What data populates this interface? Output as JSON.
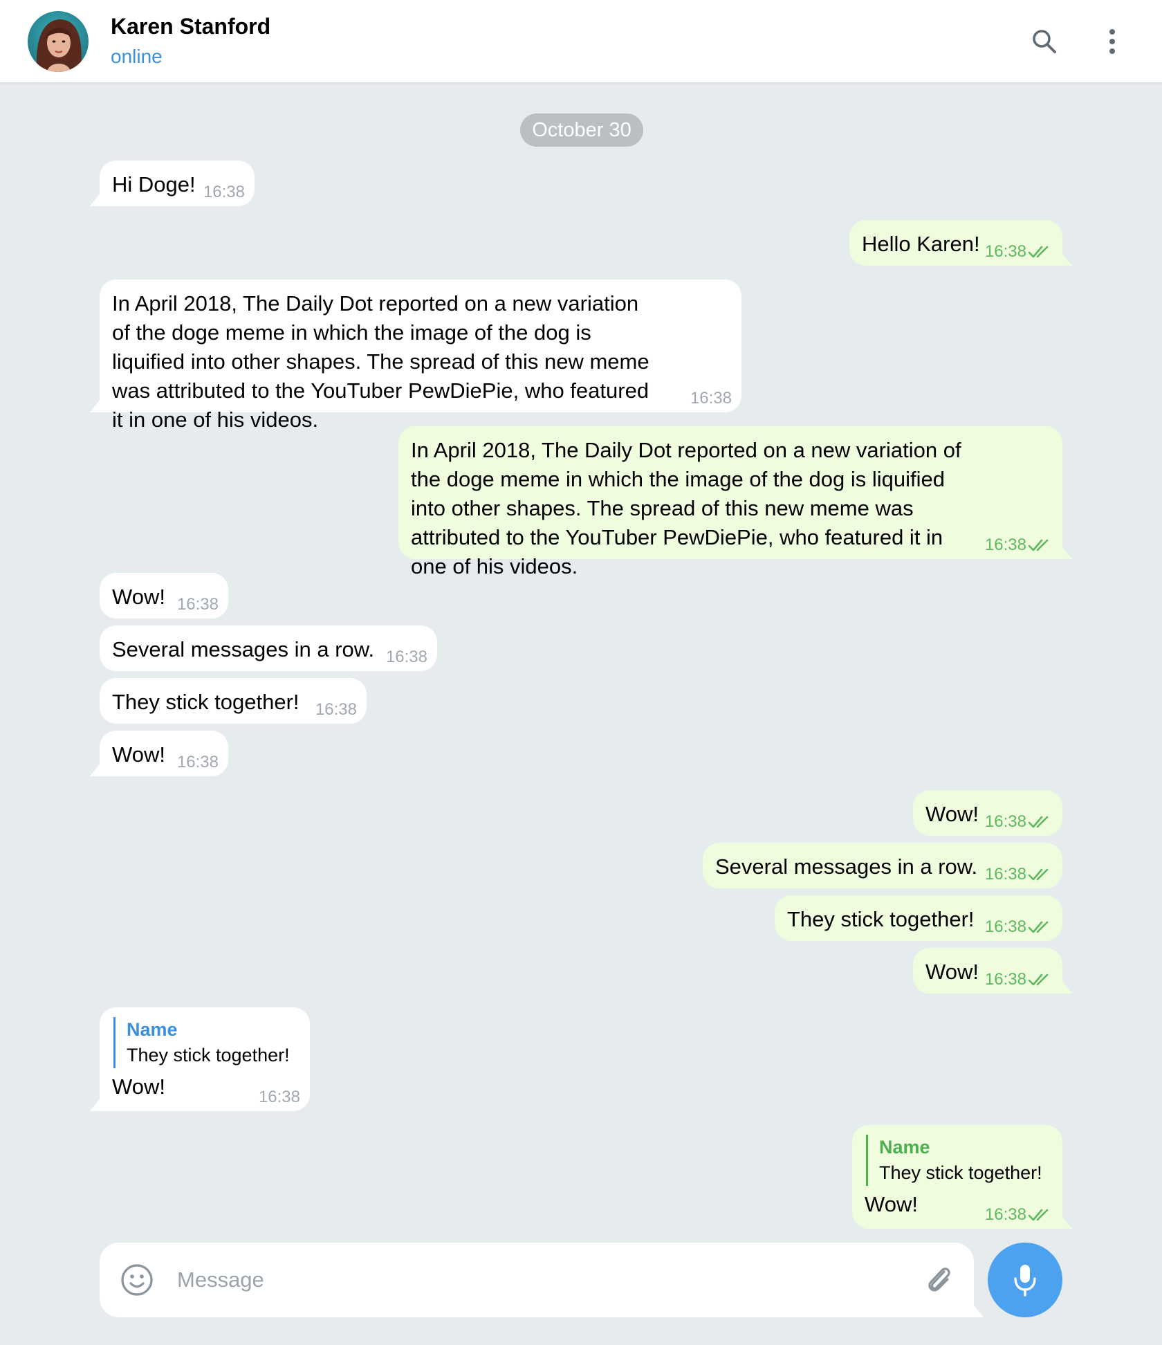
{
  "header": {
    "contact_name": "Karen Stanford",
    "status": "online"
  },
  "date_separator": "October 30",
  "messages": [
    {
      "text": "Hi Doge!",
      "time": "16:38"
    },
    {
      "text": "Hello Karen!",
      "time": "16:38"
    },
    {
      "text": "In April 2018, The Daily Dot reported on a new variation of the doge meme in which the image of the dog is liquified into other shapes. The spread of this new meme was attributed to the YouTuber PewDiePie, who featured it in one of his videos.",
      "time": "16:38"
    },
    {
      "text": "In April 2018, The Daily Dot reported on a new variation of the doge meme in which the image of the dog is liquified into other shapes. The spread of this new meme was attributed to the YouTuber PewDiePie, who featured it in one of his videos.",
      "time": "16:38"
    },
    {
      "text": "Wow!",
      "time": "16:38"
    },
    {
      "text": "Several messages in a row.",
      "time": "16:38"
    },
    {
      "text": "They stick together!",
      "time": "16:38"
    },
    {
      "text": "Wow!",
      "time": "16:38"
    },
    {
      "text": "Wow!",
      "time": "16:38"
    },
    {
      "text": "Several messages in a row.",
      "time": "16:38"
    },
    {
      "text": "They stick together!",
      "time": "16:38"
    },
    {
      "text": "Wow!",
      "time": "16:38"
    },
    {
      "reply_name": "Name",
      "reply_text": "They stick together!",
      "text": "Wow!",
      "time": "16:38"
    },
    {
      "reply_name": "Name",
      "reply_text": "They stick together!",
      "text": "Wow!",
      "time": "16:38"
    }
  ],
  "composer": {
    "placeholder": "Message"
  },
  "colors": {
    "accent": "#3a8fde",
    "incoming_bubble": "#ffffff",
    "outgoing_bubble": "#effdde",
    "outgoing_meta": "#5fb85f",
    "mic_button": "#4ca2ef",
    "chat_background": "#e6ebee"
  },
  "icons": {
    "search": "search-icon",
    "menu": "more-vertical-icon",
    "read_receipt": "double-check-icon",
    "emoji": "smiley-icon",
    "attach": "paperclip-icon",
    "mic": "microphone-icon"
  }
}
